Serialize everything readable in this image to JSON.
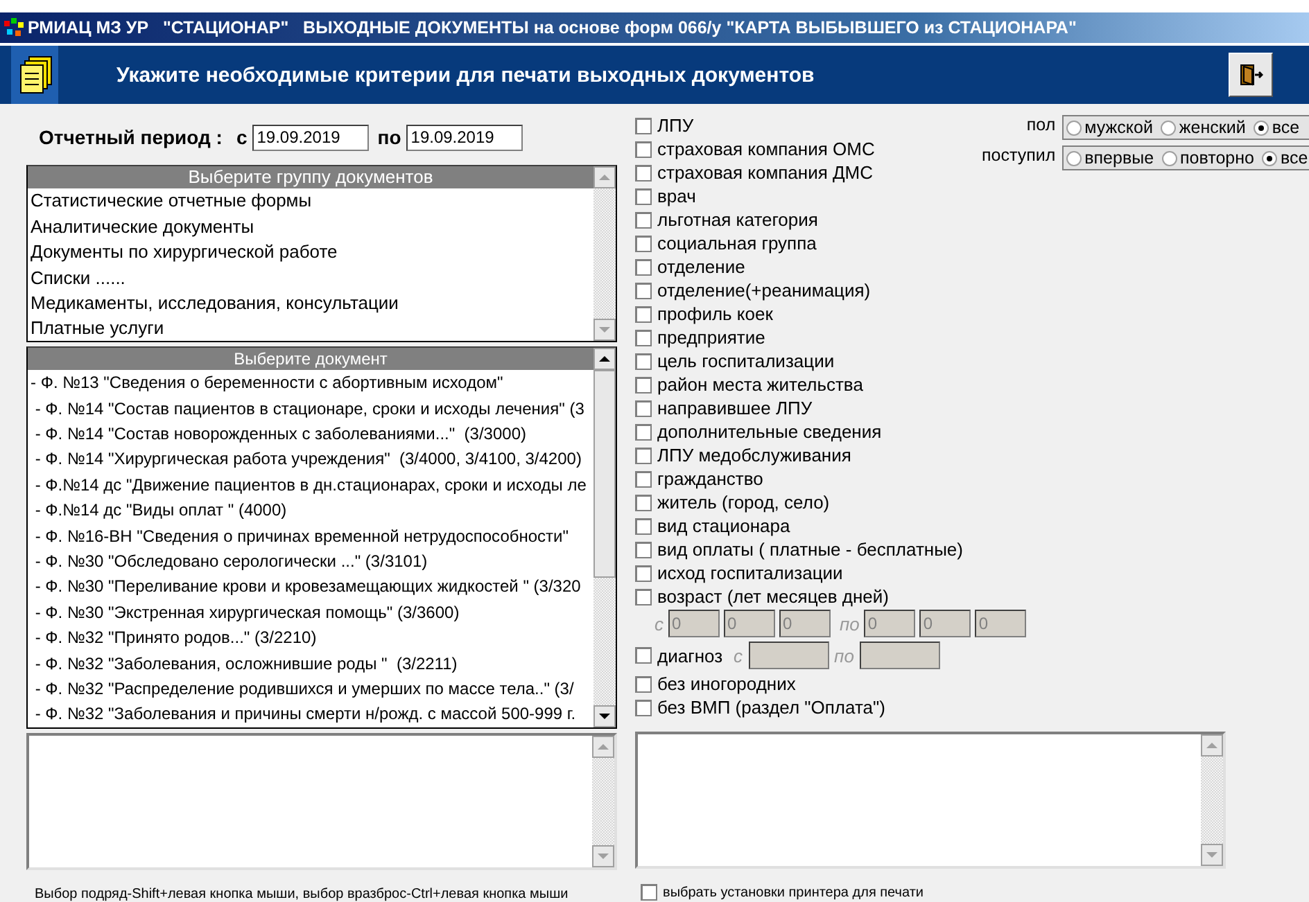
{
  "title_bar": {
    "title": "РМИАЦ МЗ УР   \"СТАЦИОНАР\"   ВЫХОДНЫЕ ДОКУМЕНТЫ на основе форм 066/у \"КАРТА ВЫБЫВШЕГО из СТАЦИОНАРА\""
  },
  "header": {
    "title": "Укажите необходимые критерии для печати выходных документов"
  },
  "period": {
    "label": "Отчетный период :",
    "from_label": "с",
    "from": "19.09.2019",
    "to_label": "по",
    "to": "19.09.2019"
  },
  "group_list": {
    "heading": "Выберите группу документов",
    "items": [
      "Статистические отчетные формы",
      "Аналитические документы",
      "Документы по хирургической работе",
      "Списки ......",
      "Медикаменты, исследования, консультации",
      "Платные услуги"
    ]
  },
  "document_list": {
    "heading": "Выберите документ",
    "items": [
      "- Ф. №13 \"Сведения о беременности с абортивным исходом\"",
      " - Ф. №14 \"Состав пациентов в стационаре, сроки и исходы лечения\" (3",
      " - Ф. №14 \"Состав новорожденных с заболеваниями...\"  (3/3000)",
      " - Ф. №14 \"Хирургическая работа учреждения\"  (3/4000, 3/4100, 3/4200)",
      " - Ф.№14 дс \"Движение пациентов в дн.стационарах, сроки и исходы ле",
      " - Ф.№14 дс \"Виды оплат \" (4000)",
      " - Ф. №16-ВН \"Сведения о причинах временной нетрудоспособности\"",
      " - Ф. №30 \"Обследовано серологически ...\" (3/3101)",
      " - Ф. №30 \"Переливание крови и кровезамещающих жидкостей \" (3/320",
      " - Ф. №30 \"Экстренная хирургическая помощь\" (3/3600)",
      " - Ф. №32 \"Принято родов...\" (3/2210)",
      " - Ф. №32 \"Заболевания, осложнившие роды \"  (3/2211)",
      " - Ф. №32 \"Распределение родившихся и умерших по массе тела..\" (3/",
      " - Ф. №32 \"Заболевания и причины смерти н/рожд. с массой 500-999 г."
    ]
  },
  "hint": "Выбор подряд-Shift+левая кнопка мыши, выбор вразброс-Ctrl+левая кнопка мыши",
  "criteria": [
    {
      "kind": "check",
      "label": "ЛПУ",
      "checked": false
    },
    {
      "kind": "check",
      "label": "страховая компания ОМС",
      "checked": false
    },
    {
      "kind": "check",
      "label": "страховая компания ДМС",
      "checked": false
    },
    {
      "kind": "check",
      "label": "врач",
      "checked": false
    },
    {
      "kind": "check",
      "label": "льготная категория",
      "checked": false
    },
    {
      "kind": "check",
      "label": "социальная группа",
      "checked": false
    },
    {
      "kind": "check",
      "label": "отделение",
      "checked": false
    },
    {
      "kind": "check",
      "label": "отделение(+реанимация)",
      "checked": false
    },
    {
      "kind": "check",
      "label": "профиль коек",
      "checked": false
    },
    {
      "kind": "check",
      "label": "предприятие",
      "checked": false
    },
    {
      "kind": "check",
      "label": "цель госпитализации",
      "checked": false
    },
    {
      "kind": "check",
      "label": "район места жительства",
      "checked": false
    },
    {
      "kind": "check",
      "label": "направившее ЛПУ",
      "checked": false
    },
    {
      "kind": "check",
      "label": "дополнительные сведения",
      "checked": false
    },
    {
      "kind": "check",
      "label": "ЛПУ медобслуживания",
      "checked": false
    },
    {
      "kind": "check",
      "label": "гражданство",
      "checked": false
    },
    {
      "kind": "check",
      "label": "житель (город, село)",
      "checked": false
    },
    {
      "kind": "check",
      "label": "вид стационара",
      "checked": false
    },
    {
      "kind": "check",
      "label": "вид оплаты ( платные - бесплатные)",
      "checked": false
    },
    {
      "kind": "check",
      "label": "исход госпитализации",
      "checked": false
    },
    {
      "kind": "check",
      "label": "возраст (лет месяцев дней)",
      "checked": false
    },
    {
      "kind": "range",
      "from_label": "с",
      "from": [
        "0",
        "0",
        "0"
      ],
      "to_label": "по",
      "to": [
        "0",
        "0",
        "0"
      ]
    },
    {
      "kind": "diagnosis",
      "label": "диагноз",
      "checked": false,
      "from_label": "с",
      "to_label": "по"
    },
    {
      "kind": "check",
      "label": "без иногородних",
      "checked": false
    },
    {
      "kind": "check",
      "label": "без ВМП (раздел \"Оплата\")",
      "checked": false
    }
  ],
  "filters": [
    {
      "label": "пол",
      "options": [
        {
          "label": "мужской",
          "selected": false
        },
        {
          "label": "женский",
          "selected": false
        },
        {
          "label": "все",
          "selected": true
        }
      ]
    },
    {
      "label": "поступил",
      "options": [
        {
          "label": "впервые",
          "selected": false
        },
        {
          "label": "повторно",
          "selected": false
        },
        {
          "label": "все",
          "selected": true
        }
      ]
    }
  ],
  "printer_setup": {
    "label": "выбрать установки принтера для печати",
    "checked": false
  }
}
